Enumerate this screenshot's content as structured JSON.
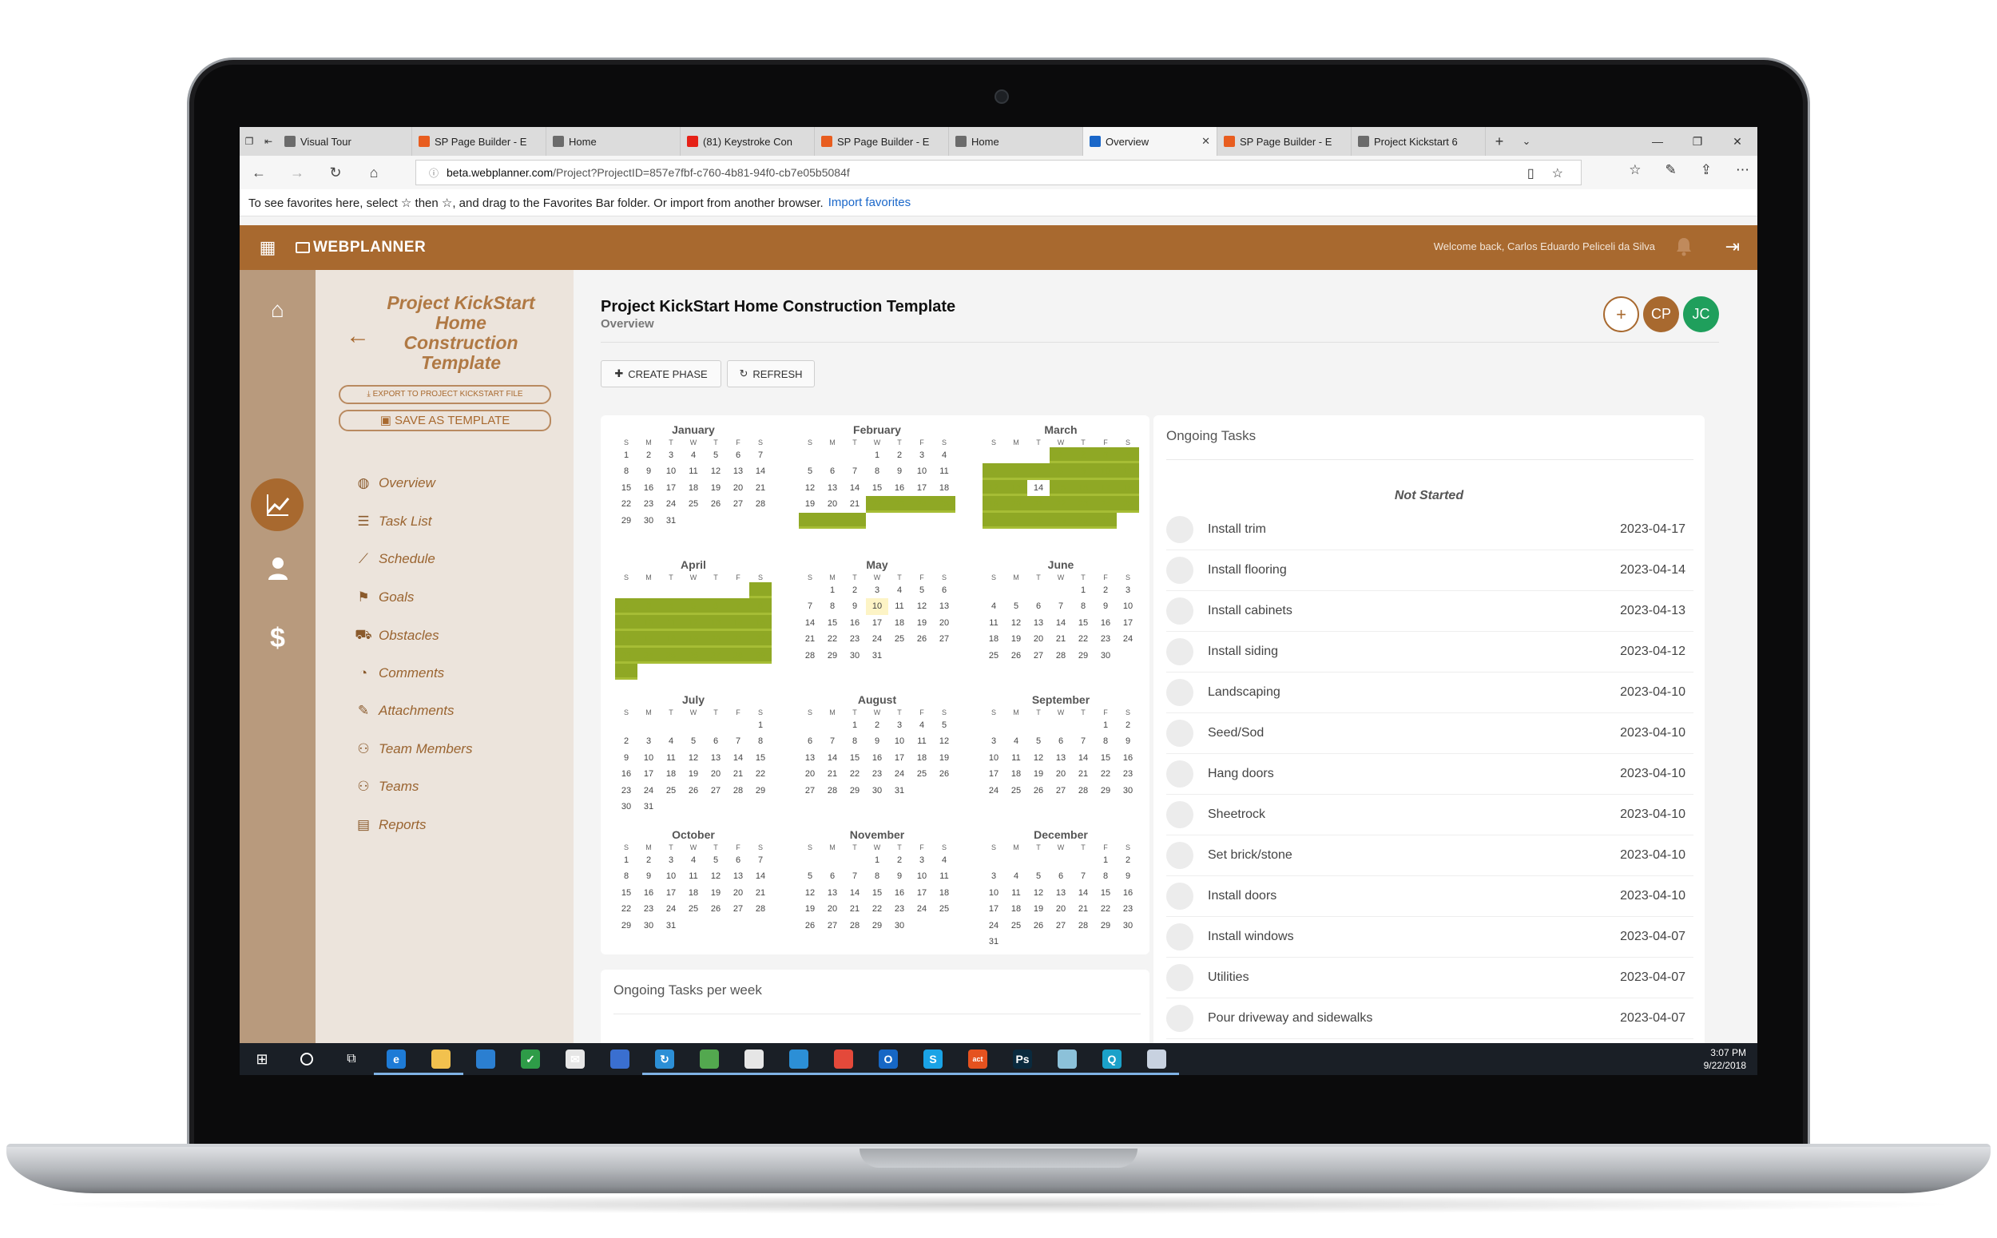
{
  "browser": {
    "tabs": [
      {
        "label": "Visual Tour",
        "color": "#6b6b6b"
      },
      {
        "label": "SP Page Builder - E",
        "color": "#e85d1f"
      },
      {
        "label": "Home",
        "color": "#6b6b6b"
      },
      {
        "label": "(81) Keystroke Con",
        "color": "#e62117"
      },
      {
        "label": "SP Page Builder - E",
        "color": "#e85d1f"
      },
      {
        "label": "Home",
        "color": "#6b6b6b"
      },
      {
        "label": "Overview",
        "color": "#1a67c9",
        "active": true
      },
      {
        "label": "SP Page Builder - E",
        "color": "#e85d1f"
      },
      {
        "label": "Project Kickstart 6",
        "color": "#6b6b6b"
      }
    ],
    "url_domain": "beta.webplanner.com",
    "url_path": "/Project?ProjectID=857e7fbf-c760-4b81-94f0-cb7e05b5084f",
    "favorites_text": "To see favorites here, select  ☆  then ☆, and drag to the Favorites Bar folder. Or import from another browser.",
    "favorites_link": "Import favorites"
  },
  "app": {
    "logo": "WEBPLANNER",
    "welcome": "Welcome back, Carlos Eduardo Peliceli da Silva",
    "accent": "#a8692f"
  },
  "sidebar": {
    "project_title": "Project KickStart Home Construction Template",
    "export_label": "EXPORT TO PROJECT KICKSTART FILE",
    "save_label": "SAVE AS TEMPLATE",
    "items": [
      {
        "label": "Overview",
        "icon": "globe-icon"
      },
      {
        "label": "Task List",
        "icon": "list-icon"
      },
      {
        "label": "Schedule",
        "icon": "chart-line-icon"
      },
      {
        "label": "Goals",
        "icon": "flag-icon"
      },
      {
        "label": "Obstacles",
        "icon": "car-icon"
      },
      {
        "label": "Comments",
        "icon": "comments-icon"
      },
      {
        "label": "Attachments",
        "icon": "paperclip-icon"
      },
      {
        "label": "Team Members",
        "icon": "users-icon"
      },
      {
        "label": "Teams",
        "icon": "users-icon"
      },
      {
        "label": "Reports",
        "icon": "file-icon"
      }
    ]
  },
  "main": {
    "title": "Project KickStart Home Construction Template",
    "subtitle": "Overview",
    "avatars": [
      {
        "label": "+",
        "kind": "add"
      },
      {
        "label": "CP",
        "kind": "cp"
      },
      {
        "label": "JC",
        "kind": "jc"
      }
    ],
    "create_phase": "CREATE PHASE",
    "refresh": "REFRESH",
    "weekday_headers": [
      "S",
      "M",
      "T",
      "W",
      "T",
      "F",
      "S"
    ],
    "months": [
      {
        "name": "January",
        "start": 0,
        "days": 31,
        "hl": []
      },
      {
        "name": "February",
        "start": 3,
        "days": 28,
        "hl": [
          22,
          23,
          24,
          25,
          26,
          27,
          28
        ]
      },
      {
        "name": "March",
        "start": 3,
        "days": 31,
        "hl": [
          1,
          2,
          3,
          4,
          5,
          6,
          7,
          8,
          9,
          10,
          11,
          12,
          13,
          15,
          16,
          17,
          18,
          19,
          20,
          21,
          22,
          23,
          24,
          25,
          26,
          27,
          28,
          29,
          30,
          31
        ]
      },
      {
        "name": "April",
        "start": 6,
        "days": 30,
        "hl": [
          1,
          2,
          3,
          4,
          5,
          6,
          7,
          8,
          9,
          10,
          11,
          12,
          13,
          14,
          15,
          16,
          17,
          18,
          19,
          20,
          21,
          22,
          23,
          24,
          25,
          26,
          27,
          28,
          29,
          30
        ]
      },
      {
        "name": "May",
        "start": 1,
        "days": 31,
        "hl": [],
        "today": 10
      },
      {
        "name": "June",
        "start": 4,
        "days": 30,
        "hl": []
      },
      {
        "name": "July",
        "start": 6,
        "days": 31,
        "hl": []
      },
      {
        "name": "August",
        "start": 2,
        "days": 31,
        "hl": []
      },
      {
        "name": "September",
        "start": 5,
        "days": 30,
        "hl": []
      },
      {
        "name": "October",
        "start": 0,
        "days": 31,
        "hl": []
      },
      {
        "name": "November",
        "start": 3,
        "days": 30,
        "hl": []
      },
      {
        "name": "December",
        "start": 5,
        "days": 31,
        "hl": []
      }
    ],
    "ongoing_title": "Ongoing Tasks",
    "status_group": "Not Started",
    "tasks": [
      {
        "name": "Install trim",
        "date": "2023-04-17"
      },
      {
        "name": "Install flooring",
        "date": "2023-04-14"
      },
      {
        "name": "Install cabinets",
        "date": "2023-04-13"
      },
      {
        "name": "Install siding",
        "date": "2023-04-12"
      },
      {
        "name": "Landscaping",
        "date": "2023-04-10"
      },
      {
        "name": "Seed/Sod",
        "date": "2023-04-10"
      },
      {
        "name": "Hang doors",
        "date": "2023-04-10"
      },
      {
        "name": "Sheetrock",
        "date": "2023-04-10"
      },
      {
        "name": "Set brick/stone",
        "date": "2023-04-10"
      },
      {
        "name": "Install doors",
        "date": "2023-04-10"
      },
      {
        "name": "Install windows",
        "date": "2023-04-07"
      },
      {
        "name": "Utilities",
        "date": "2023-04-07"
      },
      {
        "name": "Pour driveway and sidewalks",
        "date": "2023-04-07"
      }
    ],
    "week_title": "Ongoing Tasks per week"
  },
  "taskbar": {
    "icons": [
      {
        "name": "edge-icon",
        "color": "#1e7bd6",
        "glyph": "e",
        "running": true
      },
      {
        "name": "file-explorer-icon",
        "color": "#f2c14e",
        "glyph": "",
        "running": true
      },
      {
        "name": "store-icon",
        "color": "#2b7fd1",
        "glyph": ""
      },
      {
        "name": "todo-icon",
        "color": "#2e9c48",
        "glyph": "✓"
      },
      {
        "name": "mail-icon",
        "color": "#e6e6e6",
        "glyph": "✉"
      },
      {
        "name": "network-icon",
        "color": "#3a6fd0",
        "glyph": ""
      },
      {
        "name": "sync-icon",
        "color": "#2c8fd6",
        "glyph": "↻",
        "running": true
      },
      {
        "name": "app-icon",
        "color": "#53a84f",
        "glyph": "",
        "running": true
      },
      {
        "name": "dashlane-icon",
        "color": "#e6e6e6",
        "glyph": "",
        "running": true
      },
      {
        "name": "shield-icon",
        "color": "#2c8fd6",
        "glyph": "",
        "running": true
      },
      {
        "name": "chrome-icon",
        "color": "#e4493a",
        "glyph": "",
        "running": true
      },
      {
        "name": "outlook-icon",
        "color": "#1667c5",
        "glyph": "O",
        "running": true
      },
      {
        "name": "skype-icon",
        "color": "#1aa3e6",
        "glyph": "S",
        "running": true
      },
      {
        "name": "act-icon",
        "color": "#e5521f",
        "glyph": "act",
        "running": true
      },
      {
        "name": "photoshop-icon",
        "color": "#0a2a3e",
        "glyph": "Ps",
        "running": true
      },
      {
        "name": "notes-icon",
        "color": "#8cc1d9",
        "glyph": "",
        "running": true
      },
      {
        "name": "search-app-icon",
        "color": "#1ba1c9",
        "glyph": "Q",
        "running": true
      },
      {
        "name": "paint-icon",
        "color": "#c8d2e0",
        "glyph": "",
        "running": true
      }
    ],
    "time": "3:07 PM",
    "date": "9/22/2018"
  }
}
